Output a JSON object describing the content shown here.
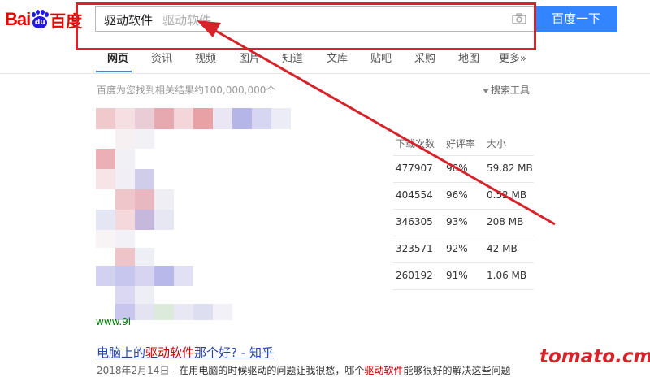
{
  "logo": {
    "bai": "Bai",
    "paw_text": "du",
    "cn": "百度"
  },
  "search": {
    "query": "驱动软件",
    "placeholder_hint": "驱动软件",
    "button_label": "百度一下"
  },
  "tabs": [
    {
      "label": "网页",
      "active": true
    },
    {
      "label": "资讯"
    },
    {
      "label": "视频"
    },
    {
      "label": "图片"
    },
    {
      "label": "知道"
    },
    {
      "label": "文库"
    },
    {
      "label": "贴吧"
    },
    {
      "label": "采购"
    },
    {
      "label": "地图"
    },
    {
      "label": "更多»"
    }
  ],
  "results": {
    "count_text": "百度为您找到相关结果约100,000,000个",
    "tools_label": "搜索工具"
  },
  "download_table": {
    "headers": [
      "下载次数",
      "好评率",
      "大小"
    ],
    "rows": [
      {
        "downloads": "477907",
        "rating": "98%",
        "size": "59.82 MB"
      },
      {
        "downloads": "404554",
        "rating": "96%",
        "size": "0.52 MB"
      },
      {
        "downloads": "346305",
        "rating": "93%",
        "size": "208 MB"
      },
      {
        "downloads": "323571",
        "rating": "92%",
        "size": "42 MB"
      },
      {
        "downloads": "260192",
        "rating": "91%",
        "size": "1.06 MB"
      }
    ]
  },
  "result1": {
    "url": "www.9i"
  },
  "result2": {
    "title_pre": "电脑上的",
    "title_hl": "驱动软件",
    "title_post": "那个好? - 知乎",
    "date": "2018年2月14日",
    "snippet_pre": " - 在用电脑的时候驱动的问题让我很愁，哪个",
    "snippet_hl": "驱动软件",
    "snippet_post": "能够很好的解决这些问题"
  },
  "watermark": "tomato.cm",
  "colors": {
    "accent": "#3385ff",
    "annotation_red": "#d6232a",
    "link": "#2440b3",
    "highlight": "#cc0000"
  },
  "icons": [
    "camera-icon",
    "filter-icon",
    "baidu-paw-icon"
  ]
}
